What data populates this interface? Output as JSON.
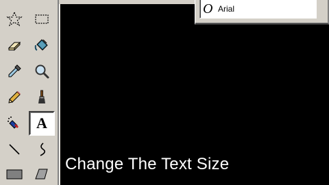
{
  "toolbox": {
    "tools": [
      {
        "name": "free-form-select-tool",
        "icon": "star-select-icon"
      },
      {
        "name": "rect-select-tool",
        "icon": "rect-select-icon"
      },
      {
        "name": "eraser-tool",
        "icon": "eraser-icon"
      },
      {
        "name": "fill-tool",
        "icon": "paint-bucket-icon"
      },
      {
        "name": "pick-color-tool",
        "icon": "eyedropper-icon"
      },
      {
        "name": "magnifier-tool",
        "icon": "magnifier-icon"
      },
      {
        "name": "pencil-tool",
        "icon": "pencil-icon"
      },
      {
        "name": "brush-tool",
        "icon": "brush-icon"
      },
      {
        "name": "airbrush-tool",
        "icon": "airbrush-icon"
      },
      {
        "name": "text-tool",
        "icon": "text-icon",
        "label": "A",
        "selected": true
      },
      {
        "name": "line-tool",
        "icon": "line-icon"
      },
      {
        "name": "curve-tool",
        "icon": "curve-icon"
      },
      {
        "name": "rectangle-tool",
        "icon": "rectangle-icon"
      },
      {
        "name": "polygon-tool",
        "icon": "polygon-icon"
      }
    ]
  },
  "font_toolbar": {
    "font_type_glyph": "O",
    "font_name": "Arial"
  },
  "canvas": {
    "background": "#000000",
    "text": "Change The Text Size",
    "text_color": "#ffffff"
  },
  "colors": {
    "chrome": "#d4d0c8",
    "shadow": "#808080",
    "highlight": "#ffffff"
  }
}
